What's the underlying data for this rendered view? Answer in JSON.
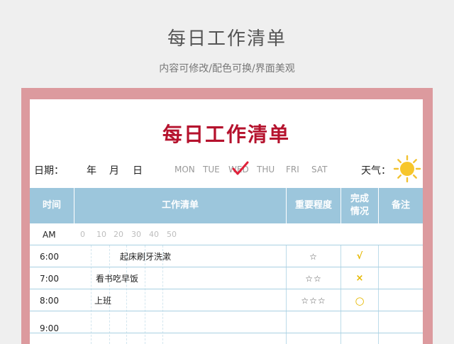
{
  "header": {
    "title": "每日工作清单",
    "subtitle": "内容可修改/配色可换/界面美观"
  },
  "sheet": {
    "title": "每日工作清单",
    "date_label": "日期：",
    "year": "年",
    "month": "月",
    "day": "日",
    "weekdays": [
      "MON",
      "TUE",
      "WED",
      "THU",
      "FRI",
      "SAT"
    ],
    "selected_weekday": "WED",
    "weather_label": "天气：",
    "weather_icon": "sun-icon",
    "colors": {
      "frame": "#dc9a9e",
      "title": "#b5122d",
      "header": "#9cc6dc",
      "check": "#e0213a",
      "mark": "#e6b800"
    }
  },
  "table": {
    "columns": [
      "时间",
      "工作清单",
      "重要程度",
      "完成\n情况",
      "备注"
    ],
    "ruler_label": "AM",
    "ruler_ticks": [
      "0",
      "10",
      "20",
      "30",
      "40",
      "50"
    ],
    "rows": [
      {
        "time": "6:00",
        "task": "起床刷牙洗漱",
        "importance": "☆",
        "status": "√"
      },
      {
        "time": "7:00",
        "task": "看书吃早饭",
        "importance": "☆☆",
        "status": "×"
      },
      {
        "time": "8:00",
        "task": "上班",
        "importance": "☆☆☆",
        "status": "○"
      },
      {
        "time": "9:00",
        "task": "",
        "importance": "",
        "status": ""
      }
    ]
  }
}
